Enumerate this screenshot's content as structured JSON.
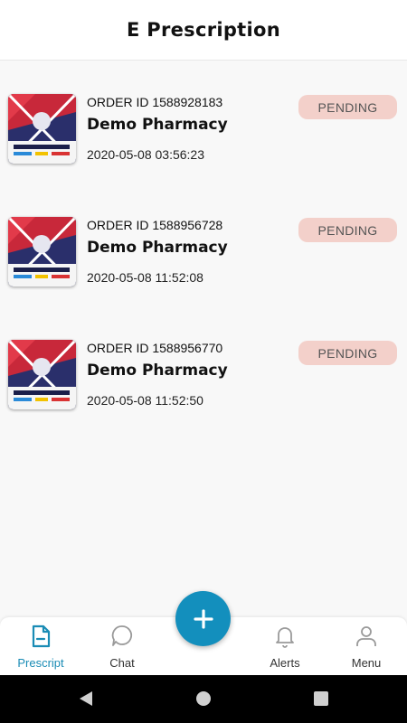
{
  "header": {
    "title": "E Prescription"
  },
  "orders": [
    {
      "order_id": "ORDER ID 1588928183",
      "pharmacy": "Demo Pharmacy",
      "date": "2020-05-08 03:56:23",
      "status": "PENDING"
    },
    {
      "order_id": "ORDER ID 1588956728",
      "pharmacy": "Demo Pharmacy",
      "date": "2020-05-08 11:52:08",
      "status": "PENDING"
    },
    {
      "order_id": "ORDER ID 1588956770",
      "pharmacy": "Demo Pharmacy",
      "date": "2020-05-08 11:52:50",
      "status": "PENDING"
    }
  ],
  "nav": {
    "prescript": "Prescript",
    "chat": "Chat",
    "alerts": "Alerts",
    "menu": "Menu"
  },
  "fab": {
    "icon": "plus-icon"
  },
  "colors": {
    "accent": "#138fbd",
    "active_tab": "#1a8cb5",
    "badge_bg": "#f3d0ca"
  }
}
